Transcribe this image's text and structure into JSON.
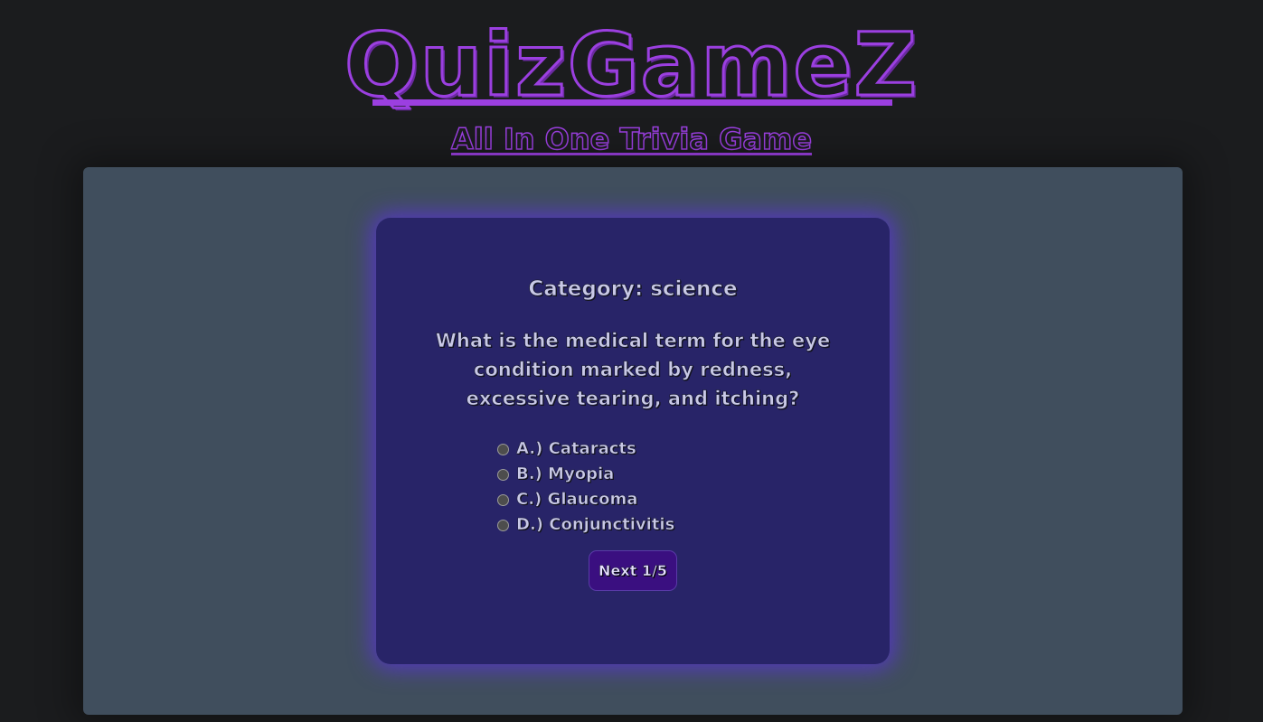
{
  "header": {
    "logo": "QuizGameZ",
    "subtitle": "All In One Trivia Game"
  },
  "quiz": {
    "category": "Category: science",
    "question": "What is the medical term for the eye condition marked by redness, excessive tearing, and itching?",
    "options": [
      {
        "label": "A.) Cataracts"
      },
      {
        "label": "B.) Myopia"
      },
      {
        "label": "C.) Glaucoma"
      },
      {
        "label": "D.) Conjunctivitis"
      }
    ],
    "next_label": "Next 1/5"
  },
  "colors": {
    "background": "#1b1c1e",
    "accent_purple": "#9b3fe0",
    "panel": "#404e5d",
    "card": "#282468",
    "button": "#3a0f80"
  }
}
